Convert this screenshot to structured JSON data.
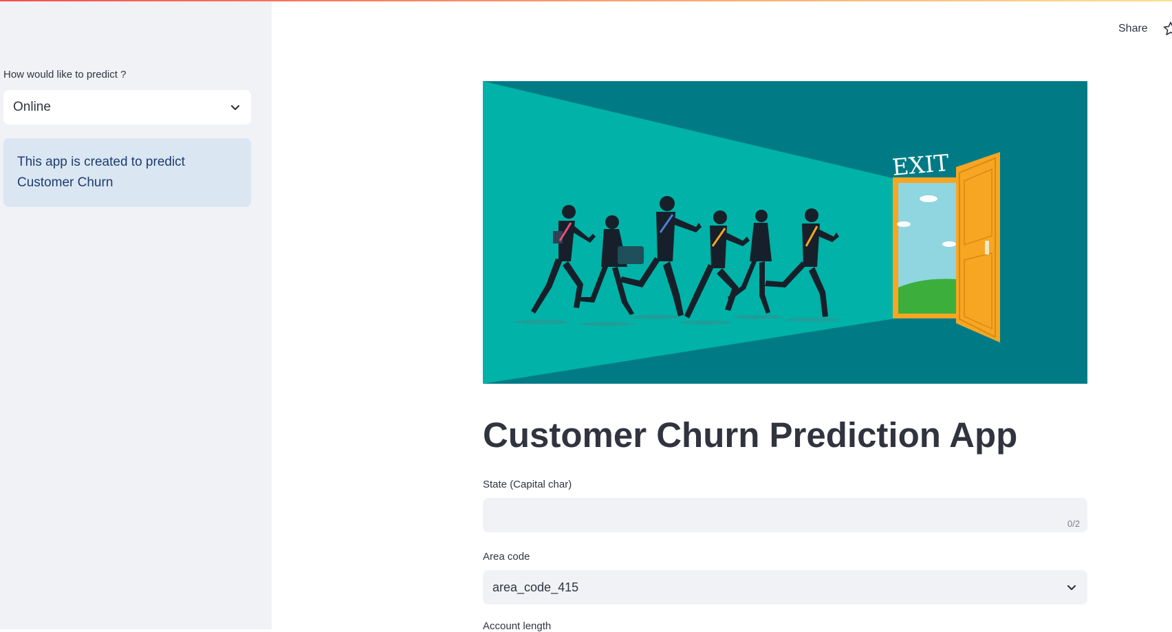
{
  "sidebar": {
    "predict_label": "How would like to predict ?",
    "predict_selected": "Online",
    "info_text": "This app is created to predict Customer Churn"
  },
  "header": {
    "share_label": "Share",
    "star_icon": "star-icon"
  },
  "hero": {
    "sign_text": "EXIT"
  },
  "main": {
    "title": "Customer Churn Prediction App",
    "state_label": "State (Capital char)",
    "state_value": "",
    "state_counter": "0/2",
    "area_label": "Area code",
    "area_selected": "area_code_415",
    "account_label": "Account length"
  },
  "colors": {
    "accent": "#ff4b4b",
    "sidebar_bg": "#f0f2f6",
    "info_bg": "#dbe6f3",
    "hero_dark": "#007b86",
    "hero_light": "#00b2a7",
    "door": "#f6a623"
  }
}
